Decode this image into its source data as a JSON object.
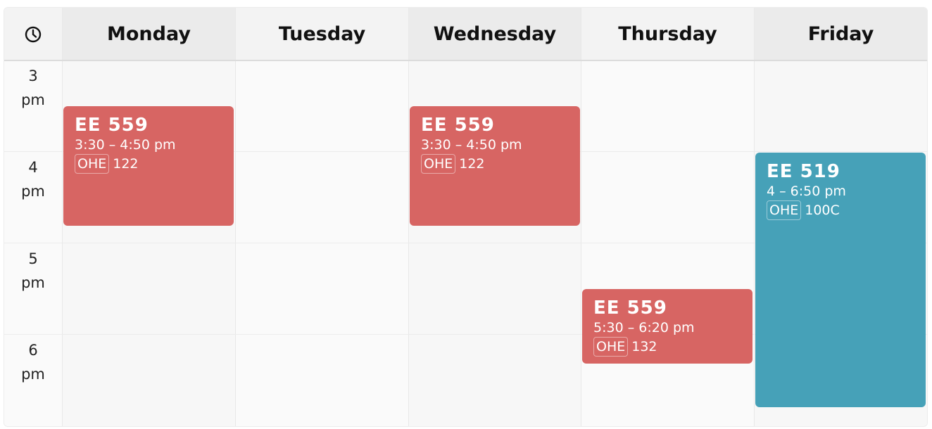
{
  "header": {
    "clock_icon": "clock-icon",
    "days": [
      "Monday",
      "Tuesday",
      "Wednesday",
      "Thursday",
      "Friday"
    ]
  },
  "hours": [
    {
      "num": "3",
      "ampm": "pm"
    },
    {
      "num": "4",
      "ampm": "pm"
    },
    {
      "num": "5",
      "ampm": "pm"
    },
    {
      "num": "6",
      "ampm": "pm"
    }
  ],
  "events": [
    {
      "day": "Monday",
      "title": "EE 559",
      "time": "3:30 – 4:50 pm",
      "building": "OHE",
      "room": "122",
      "color": "#d76563"
    },
    {
      "day": "Wednesday",
      "title": "EE 559",
      "time": "3:30 – 4:50 pm",
      "building": "OHE",
      "room": "122",
      "color": "#d76563"
    },
    {
      "day": "Thursday",
      "title": "EE 559",
      "time": "5:30 – 6:20 pm",
      "building": "OHE",
      "room": "132",
      "color": "#d76563"
    },
    {
      "day": "Friday",
      "title": "EE 519",
      "time": "4 – 6:50 pm",
      "building": "OHE",
      "room": "100C",
      "color": "#46a1b8"
    }
  ]
}
